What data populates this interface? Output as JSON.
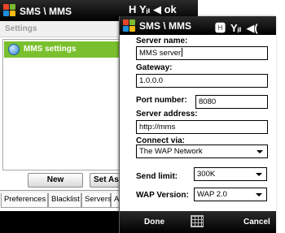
{
  "back_window": {
    "title": "SMS \\ MMS",
    "title_icons": "🅷 Y₁ ◀ ok",
    "section_title": "Settings",
    "list_items": [
      {
        "label": "MMS settings",
        "icon": "globe-icon",
        "selected": true
      }
    ],
    "buttons": {
      "new": "New",
      "set_as_default": "Set As D"
    },
    "tabs": [
      "Preferences",
      "Blacklist",
      "Servers",
      "A"
    ],
    "active_tab": "Servers"
  },
  "dialog": {
    "title": "SMS \\ MMS",
    "status_icons": [
      "data-connection-icon",
      "signal-icon",
      "volume-icon"
    ],
    "fields": {
      "server_name": {
        "label": "Server name:",
        "value": "MMS server"
      },
      "gateway": {
        "label": "Gateway:",
        "value": "1.0.0.0"
      },
      "port_number": {
        "label": "Port number:",
        "value": "8080"
      },
      "server_address": {
        "label": "Server address:",
        "value": "http://mms"
      },
      "connect_via": {
        "label": "Connect via:",
        "value": "The WAP Network"
      },
      "send_limit": {
        "label": "Send limit:",
        "value": "300K"
      },
      "wap_version": {
        "label": "WAP Version:",
        "value": "WAP 2.0"
      }
    },
    "softkeys": {
      "left": "Done",
      "right": "Cancel"
    }
  },
  "colors": {
    "selection_green": "#7ac02e",
    "titlebar": "#000000"
  }
}
